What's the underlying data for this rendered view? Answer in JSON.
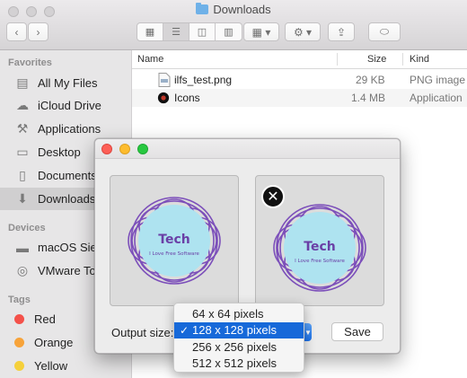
{
  "window": {
    "title": "Downloads"
  },
  "sidebar": {
    "favorites_header": "Favorites",
    "favorites": [
      {
        "label": "All My Files",
        "icon": "all-files-icon"
      },
      {
        "label": "iCloud Drive",
        "icon": "cloud-icon"
      },
      {
        "label": "Applications",
        "icon": "applications-icon"
      },
      {
        "label": "Desktop",
        "icon": "desktop-icon"
      },
      {
        "label": "Documents",
        "icon": "documents-icon"
      },
      {
        "label": "Downloads",
        "icon": "downloads-icon",
        "selected": true
      }
    ],
    "devices_header": "Devices",
    "devices": [
      {
        "label": "macOS Sierra",
        "icon": "disk-icon"
      },
      {
        "label": "VMware Tools",
        "icon": "disc-icon"
      }
    ],
    "tags_header": "Tags",
    "tags": [
      {
        "label": "Red",
        "color": "#f4514a"
      },
      {
        "label": "Orange",
        "color": "#f7a33a"
      },
      {
        "label": "Yellow",
        "color": "#f5d03b"
      }
    ]
  },
  "file_list": {
    "columns": {
      "name": "Name",
      "size": "Size",
      "kind": "Kind"
    },
    "rows": [
      {
        "name": "ilfs_test.png",
        "size": "29 KB",
        "kind": "PNG image",
        "icon": "png-file-icon"
      },
      {
        "name": "Icons",
        "size": "1.4 MB",
        "kind": "Application",
        "icon": "app-icon"
      }
    ]
  },
  "dialog": {
    "source_image": {
      "title": "Tech",
      "subtitle": "I Love Free Software"
    },
    "preview_image": {
      "title": "Tech",
      "subtitle": "I Love Free Software"
    },
    "output_size_label": "Output size:",
    "save_label": "Save",
    "size_options": [
      {
        "label": "64 x 64 pixels",
        "selected": false
      },
      {
        "label": "128 x 128 pixels",
        "selected": true
      },
      {
        "label": "256 x 256 pixels",
        "selected": false
      },
      {
        "label": "512 x 512 pixels",
        "selected": false
      }
    ],
    "checkmark": "✓"
  },
  "colors": {
    "logo_purple": "#6a3fa6",
    "logo_circle": "#aee3f0",
    "highlight": "#1669d9"
  }
}
